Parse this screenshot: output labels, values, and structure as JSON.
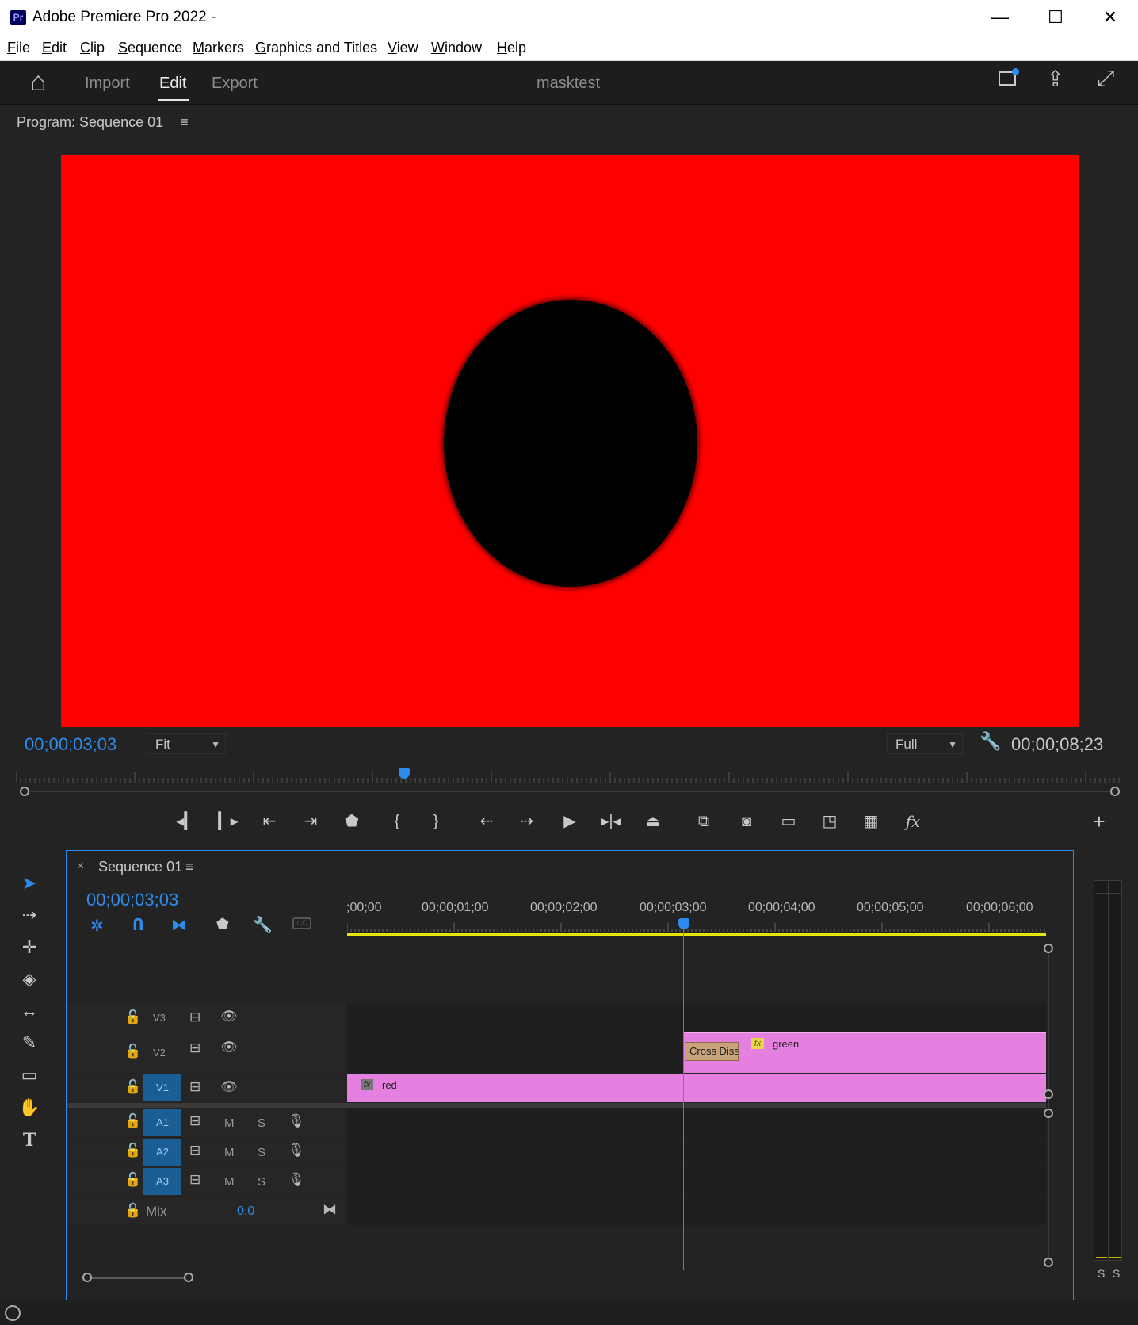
{
  "window": {
    "title": "Adobe Premiere Pro 2022 -",
    "logo": "Pr",
    "minimize_glyph": "—",
    "maximize_glyph": "☐",
    "close_glyph": "✕"
  },
  "menu": {
    "items": [
      {
        "u": "F",
        "rest": "ile"
      },
      {
        "u": "E",
        "rest": "dit"
      },
      {
        "u": "C",
        "rest": "lip"
      },
      {
        "u": "S",
        "rest": "equence"
      },
      {
        "u": "M",
        "rest": "arkers"
      },
      {
        "u": "G",
        "rest": "raphics and Titles"
      },
      {
        "u": "V",
        "rest": "iew"
      },
      {
        "u": "W",
        "rest": "indow"
      },
      {
        "u": "H",
        "rest": "elp"
      }
    ]
  },
  "header": {
    "tabs": [
      "Import",
      "Edit",
      "Export"
    ],
    "active_tab": "Edit",
    "project_name": "masktest"
  },
  "program_monitor": {
    "label": "Program: Sequence 01",
    "menu_glyph": "≡",
    "frame_color": "#ff0000",
    "mask_color": "#000000",
    "current_timecode": "00;00;03;03",
    "zoom": "Fit",
    "resolution": "Full",
    "duration": "00;00;08;23"
  },
  "timeline": {
    "tab_close": "×",
    "sequence_name": "Sequence 01",
    "menu_glyph": "≡",
    "current_timecode": "00;00;03;03",
    "ruler_labels": [
      ";00;00",
      "00;00;01;00",
      "00;00;02;00",
      "00;00;03;00",
      "00;00;04;00",
      "00;00;05;00",
      "00;00;06;00"
    ],
    "video_tracks": [
      {
        "name": "V3"
      },
      {
        "name": "V2"
      },
      {
        "name": "V1"
      }
    ],
    "audio_tracks": [
      {
        "name": "A1",
        "mute": "M",
        "solo": "S"
      },
      {
        "name": "A2",
        "mute": "M",
        "solo": "S"
      },
      {
        "name": "A3",
        "mute": "M",
        "solo": "S"
      }
    ],
    "mix": {
      "label": "Mix",
      "value": "0.0"
    },
    "clips": {
      "red": {
        "name": "red",
        "track": "V1",
        "fx": "fx"
      },
      "green": {
        "name": "green",
        "track": "V2",
        "fx": "fx"
      },
      "transition": {
        "name": "Cross Diss"
      }
    },
    "clip_color": "#e57fe0",
    "playhead_color": "#2d8ceb",
    "workarea_color": "#e6e600"
  },
  "meter": {
    "labels": [
      "S",
      "S"
    ]
  },
  "icons": {
    "home": "⌂",
    "share": "⇪",
    "fullscreen": "⤢",
    "wrench": "🔧",
    "add": "+",
    "fx_text": "fx"
  }
}
